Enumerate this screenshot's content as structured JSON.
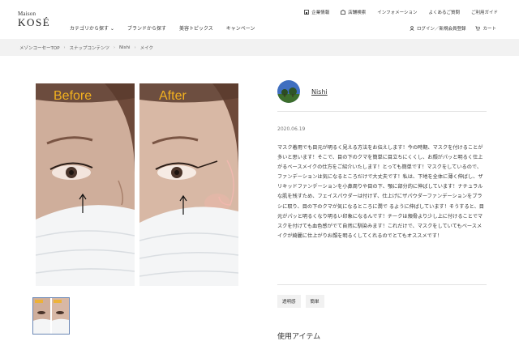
{
  "header": {
    "logo_small": "Maison",
    "logo_big": "KOSÉ",
    "nav": [
      {
        "label": "カテゴリから探す ⌄"
      },
      {
        "label": "ブランドから探す"
      },
      {
        "label": "美容トピックス"
      },
      {
        "label": "キャンペーン"
      }
    ],
    "util": [
      {
        "label": "企業情報",
        "icon": "building-icon"
      },
      {
        "label": "店舗検索",
        "icon": "store-icon"
      },
      {
        "label": "インフォメーション"
      },
      {
        "label": "よくあるご質問"
      },
      {
        "label": "ご利用ガイド"
      }
    ],
    "account": [
      {
        "label": "ログイン／新規会員登録",
        "icon": "user-icon"
      },
      {
        "label": "カート",
        "icon": "cart-icon"
      }
    ]
  },
  "breadcrumb": [
    "メゾンコーセーTOP",
    "スナップコンテンツ",
    "Nishi",
    "メイク"
  ],
  "gallery": {
    "before_label": "Before",
    "after_label": "After"
  },
  "post": {
    "username": "Nishi",
    "date": "2020.06.19",
    "body": "マスク着用でも目元が明るく見える方法をお伝えします！今の時期、マスクを付けることが多いと思います！そこで、目の下のクマを簡単に目立ちにくくし、お顔がパッと明るく仕上がるベースメイクの仕方をご紹介いたします！とっても簡単です！マスクをしているので、ファンデーションは気になるところだけで大丈夫です！私は、下地を全体に薄く伸ばし、ザリキッドファンデーションを小鼻周りや目の下、顎に部分的に伸ばしています！ナチュラルな肌を残すため、フェイスパウダーは付けず、仕上げにザパウダーファンデーションをブラシに取り、目の下のクマが気になるところに潤で るように伸ばしています！そうすると、目元がパッと明るくなり明るい印象になるんです！チークは頬骨より少し上に付けることでマスクを付けても血色感がでて自然に馴染みます！これだけで、マスクをしていてもベースメイクが綺麗に仕上がりお顔を明るくしてくれるのでとてもオススメです！",
    "tags": [
      "透明感",
      "簡単"
    ],
    "section_title": "使用アイテム"
  },
  "colors": {
    "accent_label": "#f2b11f",
    "thumb_border": "#6b87b5"
  }
}
